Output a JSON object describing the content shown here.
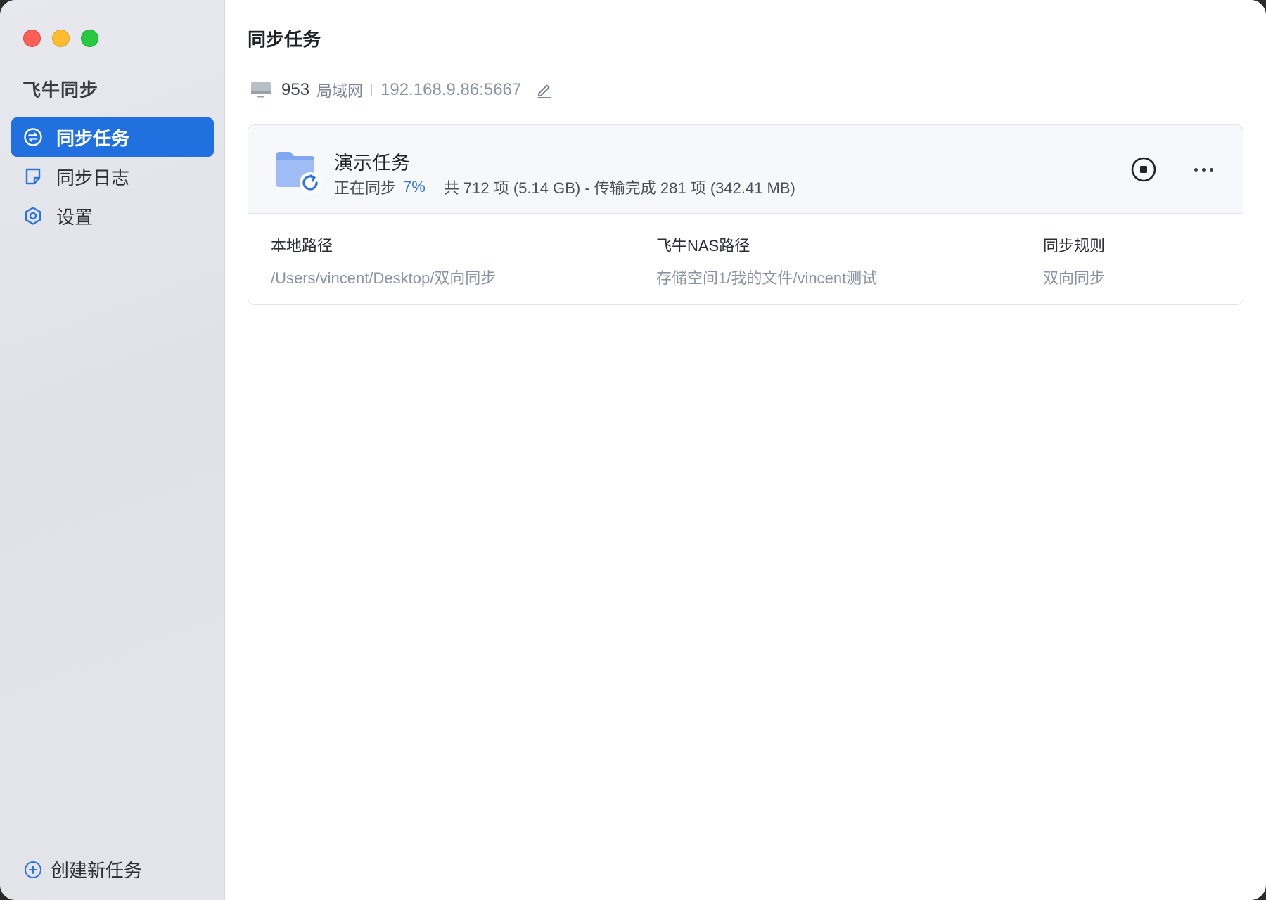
{
  "app": {
    "title": "飞牛同步"
  },
  "sidebar": {
    "items": [
      {
        "label": "同步任务",
        "icon": "sync-circle-icon",
        "active": true
      },
      {
        "label": "同步日志",
        "icon": "log-note-icon",
        "active": false
      },
      {
        "label": "设置",
        "icon": "gear-icon",
        "active": false
      }
    ],
    "create_label": "创建新任务"
  },
  "main": {
    "title": "同步任务",
    "server": {
      "name": "953",
      "network": "局域网",
      "address": "192.168.9.86:5667"
    },
    "task": {
      "name": "演示任务",
      "status": "正在同步",
      "progress": "7%",
      "summary": "共 712 项 (5.14 GB) - 传输完成 281 项 (342.41 MB)",
      "columns": [
        {
          "header": "本地路径",
          "value": "/Users/vincent/Desktop/双向同步"
        },
        {
          "header": "飞牛NAS路径",
          "value": "存储空间1/我的文件/vincent测试"
        },
        {
          "header": "同步规则",
          "value": "双向同步"
        }
      ]
    }
  },
  "colors": {
    "accent": "#2070e0",
    "progress": "#2f73e0",
    "folder": "#7fa8f0"
  }
}
